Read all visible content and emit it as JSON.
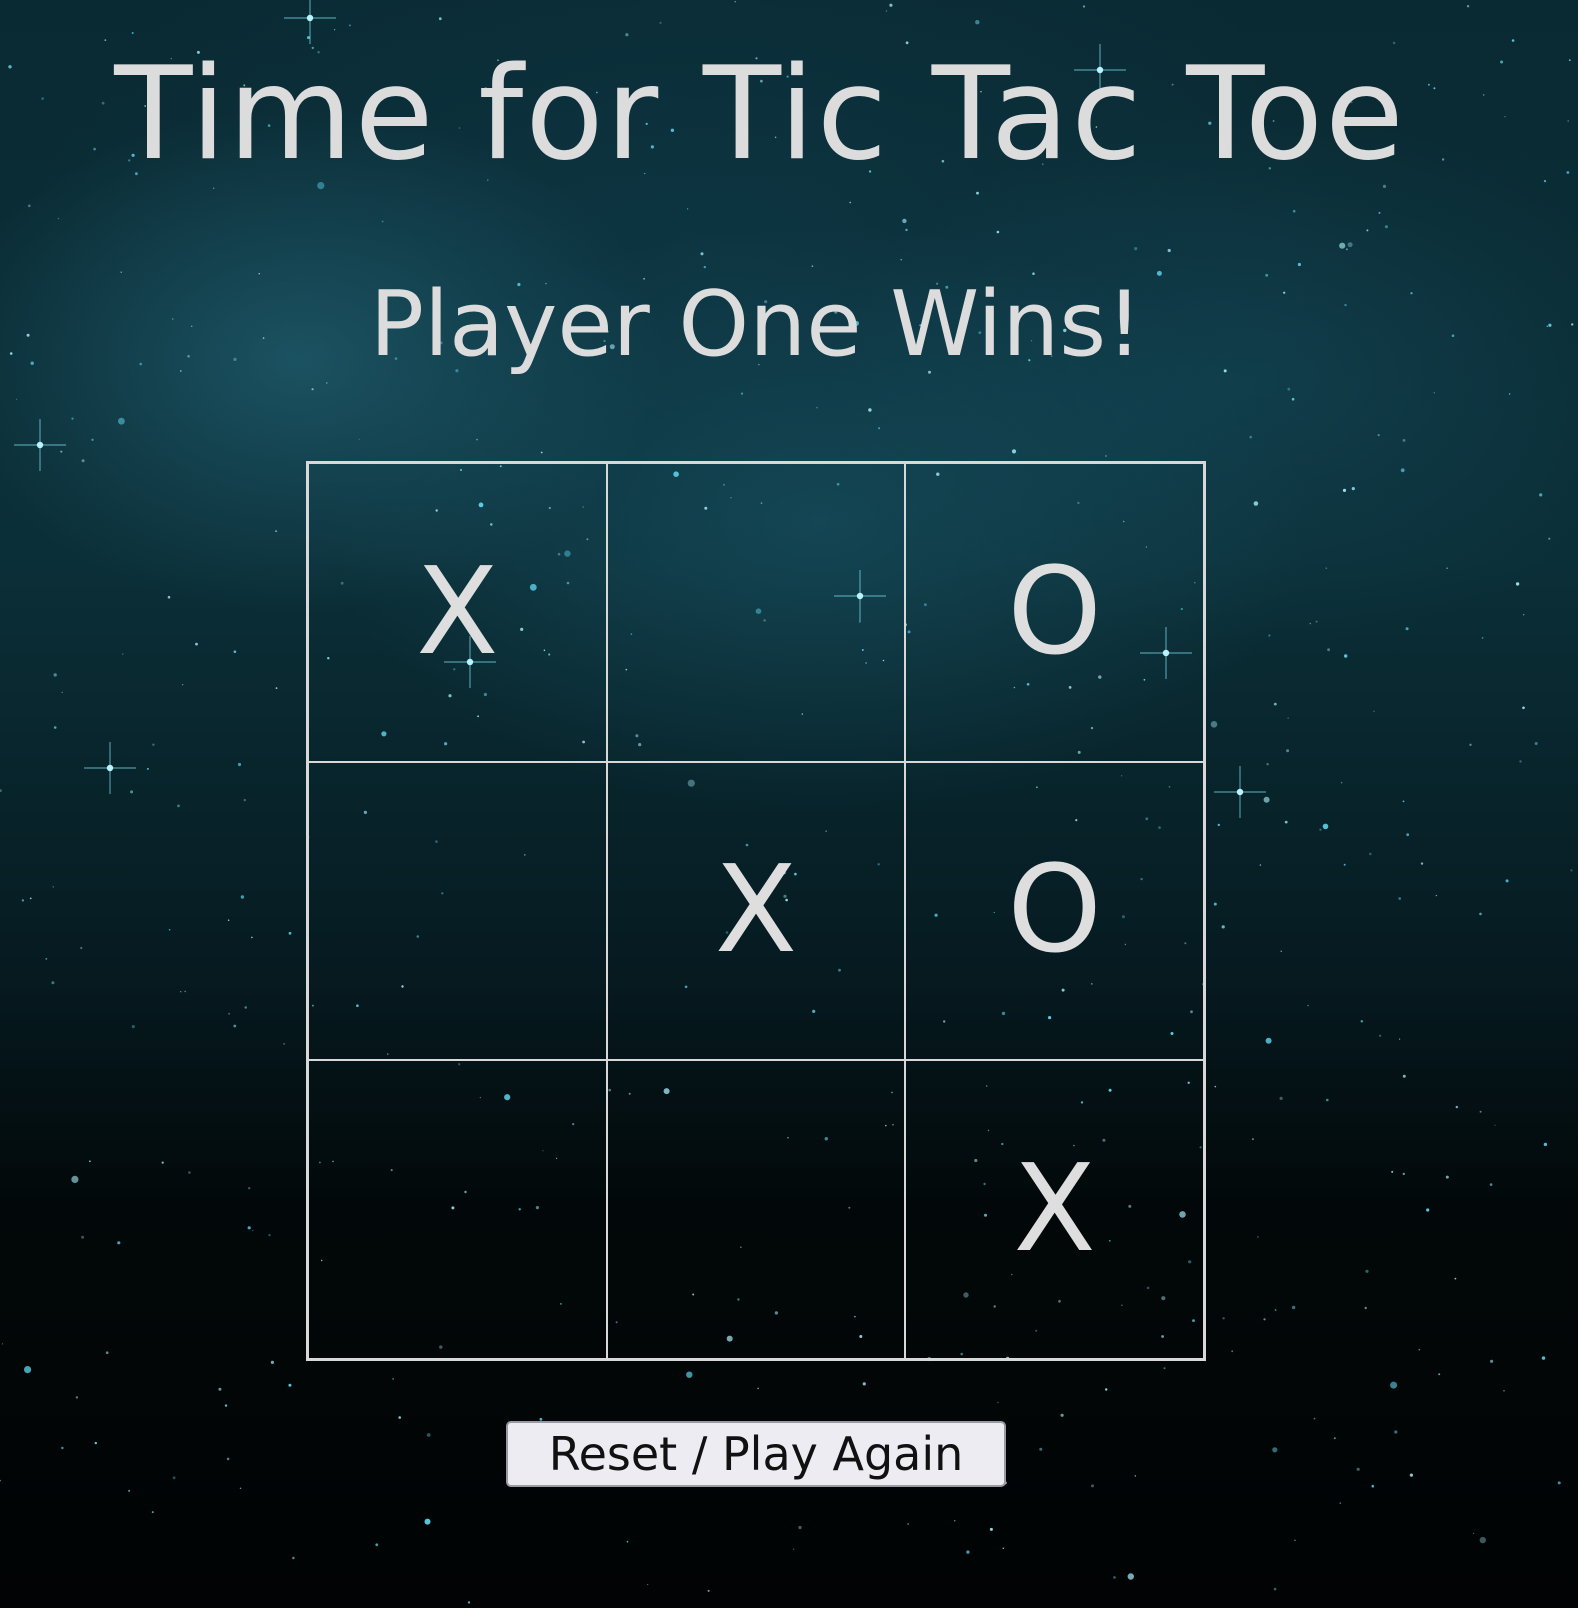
{
  "header": {
    "title": "Time for Tic Tac Toe"
  },
  "status": {
    "message": "Player One Wins!"
  },
  "board": {
    "cells": [
      "X",
      "",
      "O",
      "",
      "X",
      "O",
      "",
      "",
      "X"
    ]
  },
  "controls": {
    "reset_label": "Reset / Play Again"
  },
  "colors": {
    "text": "#dcdcdc",
    "grid_lines": "#d8d8d8",
    "button_bg": "#ececf2",
    "background_accent": "#1e5f73"
  }
}
